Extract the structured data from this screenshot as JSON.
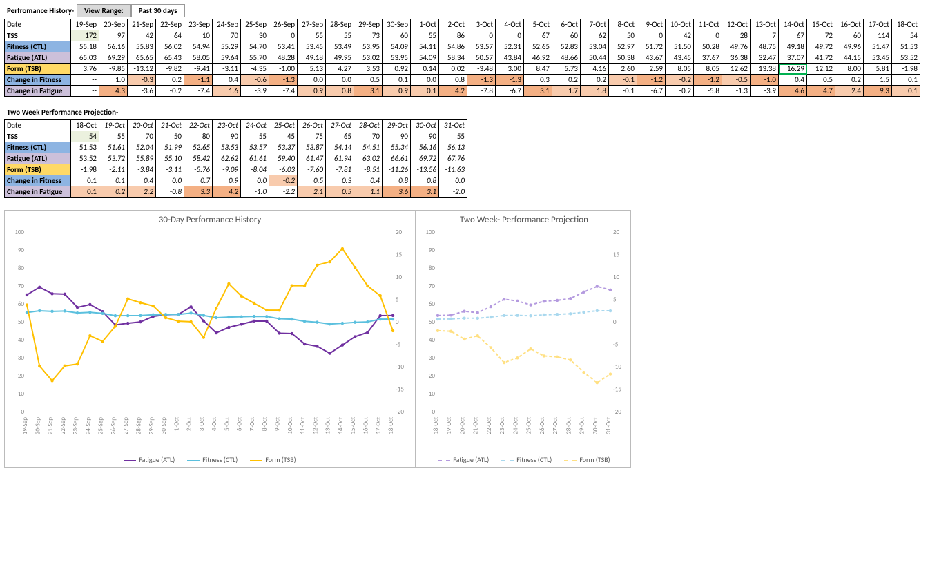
{
  "history_title": "Perfromance History-",
  "view_range_label": "View Range:",
  "view_range_value": "Past 30 days",
  "projection_title": "Two Week Performance Projection-",
  "row_labels": {
    "date": "Date",
    "tss": "TSS",
    "ctl": "Fitness (CTL)",
    "atl": "Fatigue (ATL)",
    "tsb": "Form (TSB)",
    "dctl": "Change in Fitness",
    "datl": "Change in Fatigue"
  },
  "history": {
    "dates": [
      "19-Sep",
      "20-Sep",
      "21-Sep",
      "22-Sep",
      "23-Sep",
      "24-Sep",
      "25-Sep",
      "26-Sep",
      "27-Sep",
      "28-Sep",
      "29-Sep",
      "30-Sep",
      "1-Oct",
      "2-Oct",
      "3-Oct",
      "4-Oct",
      "5-Oct",
      "6-Oct",
      "7-Oct",
      "8-Oct",
      "9-Oct",
      "10-Oct",
      "11-Oct",
      "12-Oct",
      "13-Oct",
      "14-Oct",
      "15-Oct",
      "16-Oct",
      "17-Oct",
      "18-Oct"
    ],
    "tss": [
      172,
      97,
      42,
      64,
      10,
      70,
      30,
      0,
      55,
      55,
      73,
      60,
      55,
      86,
      0,
      0,
      67,
      60,
      62,
      50,
      0,
      42,
      0,
      28,
      7,
      67,
      72,
      60,
      114,
      54
    ],
    "ctl": [
      55.18,
      56.16,
      55.83,
      56.02,
      54.94,
      55.29,
      54.7,
      53.41,
      53.45,
      53.49,
      53.95,
      54.09,
      54.11,
      54.86,
      53.57,
      52.31,
      52.65,
      52.83,
      53.04,
      52.97,
      51.72,
      51.5,
      50.28,
      49.76,
      48.75,
      49.18,
      49.72,
      49.96,
      51.47,
      51.53
    ],
    "atl": [
      65.03,
      69.29,
      65.65,
      65.43,
      58.05,
      59.64,
      55.7,
      48.28,
      49.18,
      49.95,
      53.02,
      53.95,
      54.09,
      58.34,
      50.57,
      43.84,
      46.92,
      48.66,
      50.44,
      50.38,
      43.67,
      43.45,
      37.67,
      36.38,
      32.47,
      37.07,
      41.72,
      44.15,
      53.45,
      53.52
    ],
    "tsb": [
      3.76,
      -9.85,
      -13.12,
      -9.82,
      -9.41,
      -3.11,
      -4.35,
      -1.0,
      5.13,
      4.27,
      3.53,
      0.92,
      0.14,
      0.02,
      -3.48,
      3.0,
      8.47,
      5.73,
      4.16,
      2.6,
      2.59,
      8.05,
      8.05,
      12.62,
      13.38,
      16.29,
      12.12,
      8.0,
      5.81,
      -1.98
    ],
    "dctl": [
      "--",
      1.0,
      -0.3,
      0.2,
      -1.1,
      0.4,
      -0.6,
      -1.3,
      0.0,
      0.0,
      0.5,
      0.1,
      0.0,
      0.8,
      -1.3,
      -1.3,
      0.3,
      0.2,
      0.2,
      -0.1,
      -1.2,
      -0.2,
      -1.2,
      -0.5,
      -1.0,
      0.4,
      0.5,
      0.2,
      1.5,
      0.1
    ],
    "datl": [
      "--",
      4.3,
      -3.6,
      -0.2,
      -7.4,
      1.6,
      -3.9,
      -7.4,
      0.9,
      0.8,
      3.1,
      0.9,
      0.1,
      4.2,
      -7.8,
      -6.7,
      3.1,
      1.7,
      1.8,
      -0.1,
      -6.7,
      -0.2,
      -5.8,
      -1.3,
      -3.9,
      4.6,
      4.7,
      2.4,
      9.3,
      0.1
    ]
  },
  "projection": {
    "dates": [
      "18-Oct",
      "19-Oct",
      "20-Oct",
      "21-Oct",
      "22-Oct",
      "23-Oct",
      "24-Oct",
      "25-Oct",
      "26-Oct",
      "27-Oct",
      "28-Oct",
      "29-Oct",
      "30-Oct",
      "31-Oct"
    ],
    "tss": [
      54,
      55,
      70,
      50,
      80,
      90,
      55,
      45,
      75,
      65,
      70,
      90,
      90,
      55
    ],
    "ctl": [
      51.53,
      51.61,
      52.04,
      51.99,
      52.65,
      53.53,
      53.57,
      53.37,
      53.87,
      54.14,
      54.51,
      55.34,
      56.16,
      56.13
    ],
    "atl": [
      53.52,
      53.72,
      55.89,
      55.1,
      58.42,
      62.62,
      61.61,
      59.4,
      61.47,
      61.94,
      63.02,
      66.61,
      69.72,
      67.76
    ],
    "tsb": [
      -1.98,
      -2.11,
      -3.84,
      -3.11,
      -5.76,
      -9.09,
      -8.04,
      -6.03,
      -7.6,
      -7.81,
      -8.51,
      -11.26,
      -13.56,
      -11.63
    ],
    "dctl": [
      0.1,
      0.1,
      0.4,
      0.0,
      0.7,
      0.9,
      0.0,
      -0.2,
      0.5,
      0.3,
      0.4,
      0.8,
      0.8,
      0.0
    ],
    "datl": [
      0.1,
      0.2,
      2.2,
      -0.8,
      3.3,
      4.2,
      -1.0,
      -2.2,
      2.1,
      0.5,
      1.1,
      3.6,
      3.1,
      -2.0
    ]
  },
  "chart_data": [
    {
      "type": "line",
      "title": "30-Day Performance History",
      "x": [
        "19-Sep",
        "20-Sep",
        "21-Sep",
        "22-Sep",
        "23-Sep",
        "24-Sep",
        "25-Sep",
        "26-Sep",
        "27-Sep",
        "28-Sep",
        "29-Sep",
        "30-Sep",
        "1-Oct",
        "2-Oct",
        "3-Oct",
        "4-Oct",
        "5-Oct",
        "6-Oct",
        "7-Oct",
        "8-Oct",
        "9-Oct",
        "10-Oct",
        "11-Oct",
        "12-Oct",
        "13-Oct",
        "14-Oct",
        "15-Oct",
        "16-Oct",
        "17-Oct",
        "18-Oct"
      ],
      "y_left_lim": [
        0,
        100
      ],
      "y_right_lim": [
        -20,
        20
      ],
      "series": [
        {
          "name": "Fatigue (ATL)",
          "axis": "left",
          "color": "#7030a0",
          "values": [
            65.03,
            69.29,
            65.65,
            65.43,
            58.05,
            59.64,
            55.7,
            48.28,
            49.18,
            49.95,
            53.02,
            53.95,
            54.09,
            58.34,
            50.57,
            43.84,
            46.92,
            48.66,
            50.44,
            50.38,
            43.67,
            43.45,
            37.67,
            36.38,
            32.47,
            37.07,
            41.72,
            44.15,
            53.45,
            53.52
          ]
        },
        {
          "name": "Fitness (CTL)",
          "axis": "left",
          "color": "#5bc0de",
          "values": [
            55.18,
            56.16,
            55.83,
            56.02,
            54.94,
            55.29,
            54.7,
            53.41,
            53.45,
            53.49,
            53.95,
            54.09,
            54.11,
            54.86,
            53.57,
            52.31,
            52.65,
            52.83,
            53.04,
            52.97,
            51.72,
            51.5,
            50.28,
            49.76,
            48.75,
            49.18,
            49.72,
            49.96,
            51.47,
            51.53
          ]
        },
        {
          "name": "Form (TSB)",
          "axis": "right",
          "color": "#ffc000",
          "values": [
            3.76,
            -9.85,
            -13.12,
            -9.82,
            -9.41,
            -3.11,
            -4.35,
            -1.0,
            5.13,
            4.27,
            3.53,
            0.92,
            0.14,
            0.02,
            -3.48,
            3.0,
            8.47,
            5.73,
            4.16,
            2.6,
            2.59,
            8.05,
            8.05,
            12.62,
            13.38,
            16.29,
            12.12,
            8.0,
            5.81,
            -1.98
          ]
        }
      ]
    },
    {
      "type": "line",
      "title": "Two Week- Performance Projection",
      "x": [
        "18-Oct",
        "19-Oct",
        "20-Oct",
        "21-Oct",
        "22-Oct",
        "23-Oct",
        "24-Oct",
        "25-Oct",
        "26-Oct",
        "27-Oct",
        "28-Oct",
        "29-Oct",
        "30-Oct",
        "31-Oct"
      ],
      "y_left_lim": [
        0,
        100
      ],
      "y_right_lim": [
        -20,
        20
      ],
      "dashed": true,
      "series": [
        {
          "name": "Fatigue (ATL)",
          "axis": "left",
          "color": "#b49adf",
          "values": [
            53.52,
            53.72,
            55.89,
            55.1,
            58.42,
            62.62,
            61.61,
            59.4,
            61.47,
            61.94,
            63.02,
            66.61,
            69.72,
            67.76
          ]
        },
        {
          "name": "Fitness (CTL)",
          "axis": "left",
          "color": "#a9d8ee",
          "values": [
            51.53,
            51.61,
            52.04,
            51.99,
            52.65,
            53.53,
            53.57,
            53.37,
            53.87,
            54.14,
            54.51,
            55.34,
            56.16,
            56.13
          ]
        },
        {
          "name": "Form (TSB)",
          "axis": "right",
          "color": "#ffe083",
          "values": [
            -1.98,
            -2.11,
            -3.84,
            -3.11,
            -5.76,
            -9.09,
            -8.04,
            -6.03,
            -7.6,
            -7.81,
            -8.51,
            -11.26,
            -13.56,
            -11.63
          ]
        }
      ]
    }
  ],
  "legend_labels": [
    "Fatigue (ATL)",
    "Fitness (CTL)",
    "Form (TSB)"
  ]
}
